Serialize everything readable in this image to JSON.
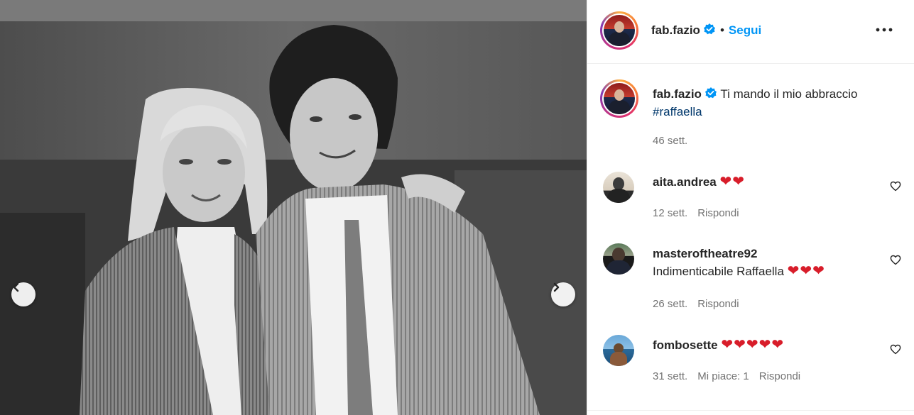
{
  "post": {
    "username": "fab.fazio",
    "separator": "•",
    "follow_label": "Segui",
    "caption_text": "Ti mando il mio abbraccio",
    "caption_hashtag": "#raffaella",
    "caption_time": "46 sett."
  },
  "comments": [
    {
      "username": "aita.andrea",
      "text": "",
      "hearts": "❤❤",
      "time": "12 sett.",
      "likes": "",
      "reply": "Rispondi"
    },
    {
      "username": "masteroftheatre92",
      "text": "Indimenticabile Raffaella",
      "hearts": "❤❤❤",
      "time": "26 sett.",
      "likes": "",
      "reply": "Rispondi"
    },
    {
      "username": "fombosette",
      "text": "",
      "hearts": "❤❤❤❤❤",
      "time": "31 sett.",
      "likes": "Mi piace: 1",
      "reply": "Rispondi"
    }
  ],
  "icons": {
    "verified": "verified-badge-icon",
    "more": "more-options-icon",
    "prev": "chevron-left-icon",
    "next": "chevron-right-icon",
    "like": "heart-outline-icon"
  },
  "colors": {
    "follow": "#0095f6",
    "verified": "#0095f6",
    "hashtag": "#00376b",
    "heart": "#d81d2a",
    "meta": "#737373"
  }
}
